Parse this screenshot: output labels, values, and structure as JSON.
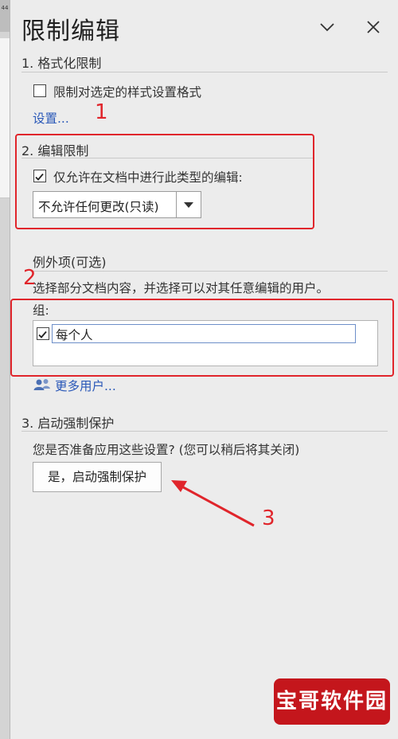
{
  "pane": {
    "title": "限制编辑",
    "colors": {
      "accent": "#2a58b8",
      "annotation": "#e0252b",
      "watermark": "#c4161c"
    }
  },
  "left_strip": {
    "number": "44"
  },
  "section1": {
    "title": "1. 格式化限制",
    "checkbox_label": "限制对选定的样式设置格式",
    "checked": false,
    "settings_link": "设置..."
  },
  "section2": {
    "title": "2. 编辑限制",
    "checkbox_label": "仅允许在文档中进行此类型的编辑:",
    "checked": true,
    "dropdown_value": "不允许任何更改(只读)"
  },
  "exceptions": {
    "title": "例外项(可选)",
    "description": "选择部分文档内容，并选择可以对其任意编辑的用户。",
    "groups_label": "组:",
    "group_entry": "每个人",
    "group_checked": true,
    "more_users_link": "更多用户..."
  },
  "section3": {
    "title": "3. 启动强制保护",
    "question": "您是否准备应用这些设置? (您可以稍后将其关闭)",
    "button": "是，启动强制保护"
  },
  "annotations": {
    "one": "1",
    "two": "2",
    "three": "3"
  },
  "watermark": "宝哥软件园"
}
